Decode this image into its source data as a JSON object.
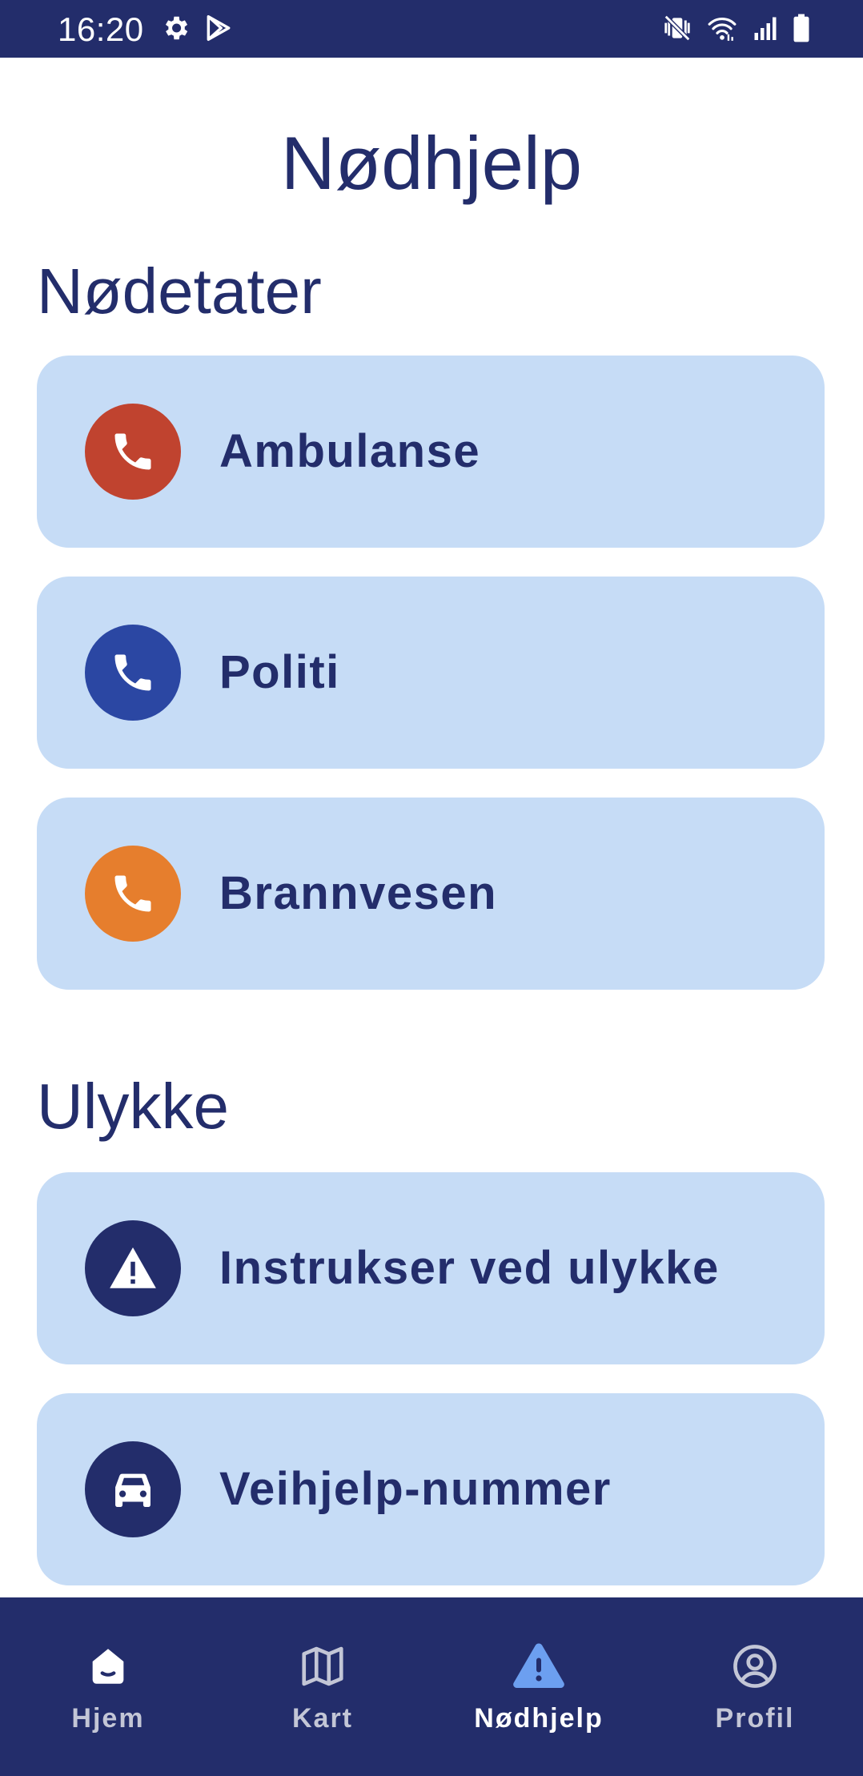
{
  "status_bar": {
    "time": "16:20",
    "icons": [
      "settings-icon",
      "play-store-icon",
      "vibrate-off-icon",
      "wifi-icon",
      "signal-icon",
      "battery-icon"
    ]
  },
  "page": {
    "title": "Nødhjelp"
  },
  "sections": [
    {
      "title": "Nødetater",
      "items": [
        {
          "label": "Ambulanse",
          "icon": "phone-icon",
          "icon_color": "#c0432f"
        },
        {
          "label": "Politi",
          "icon": "phone-icon",
          "icon_color": "#2b47a3"
        },
        {
          "label": "Brannvesen",
          "icon": "phone-icon",
          "icon_color": "#e67e2d"
        }
      ]
    },
    {
      "title": "Ulykke",
      "items": [
        {
          "label": "Instrukser ved ulykke",
          "icon": "warning-icon",
          "icon_color": "#232d6b"
        },
        {
          "label": "Veihjelp-nummer",
          "icon": "car-icon",
          "icon_color": "#232d6b"
        }
      ]
    }
  ],
  "bottom_nav": {
    "items": [
      {
        "label": "Hjem",
        "icon": "home-icon",
        "active": false
      },
      {
        "label": "Kart",
        "icon": "map-icon",
        "active": false
      },
      {
        "label": "Nødhjelp",
        "icon": "warning-icon",
        "active": true
      },
      {
        "label": "Profil",
        "icon": "profile-icon",
        "active": false
      }
    ]
  },
  "colors": {
    "primary": "#232d6b",
    "card_background": "#c6dcf6",
    "active_nav_icon": "#6c9ff0",
    "inactive_nav_label": "#c3c6d6"
  }
}
